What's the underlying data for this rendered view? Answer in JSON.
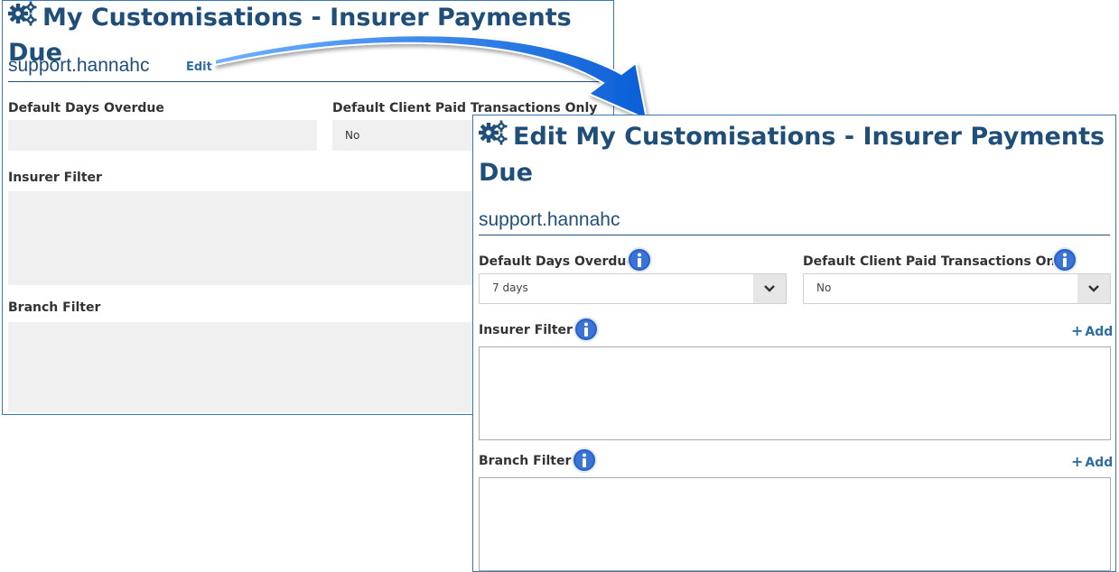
{
  "view": {
    "title": "My Customisations - Insurer Payments Due",
    "username": "support.hannahc",
    "edit_label": "Edit",
    "fields": {
      "days_overdue_label": "Default Days Overdue",
      "days_overdue_value": "",
      "client_paid_label": "Default Client Paid Transactions Only",
      "client_paid_value": "No",
      "insurer_filter_label": "Insurer Filter",
      "branch_filter_label": "Branch Filter"
    }
  },
  "edit": {
    "title_line1": "Edit My Customisations - Insurer Payments",
    "title_line2": "Due",
    "username": "support.hannahc",
    "fields": {
      "days_overdue_label": "Default Days Overdue",
      "days_overdue_value": "7 days",
      "client_paid_label": "Default Client Paid Transactions Only",
      "client_paid_value": "No",
      "insurer_filter_label": "Insurer Filter",
      "insurer_add_label": "Add",
      "branch_filter_label": "Branch Filter",
      "branch_add_label": "Add"
    }
  },
  "icons": {
    "gear": "gears-icon",
    "info": "info-icon",
    "chevron": "chevron-down-icon",
    "arrow": "callout-arrow"
  },
  "colors": {
    "heading": "#1f4e79",
    "link": "#2e6da4",
    "panel_border": "#3a78b5",
    "readonly_bg": "#f0f0f0",
    "arrow_blue": "#1a73e8"
  }
}
